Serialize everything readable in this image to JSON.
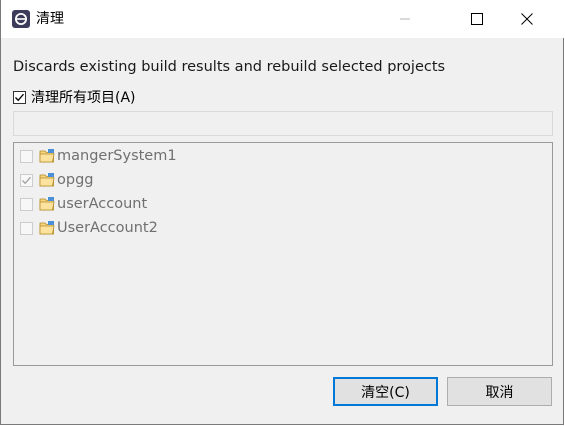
{
  "window": {
    "title": "清理",
    "controls": {
      "minimize": "minimize-icon",
      "maximize": "maximize-icon",
      "close": "close-icon"
    }
  },
  "dialog": {
    "description": "Discards existing build results and rebuild selected projects",
    "clean_all": {
      "label": "清理所有项目(A)",
      "checked": true
    },
    "filter": {
      "value": ""
    },
    "projects": [
      {
        "name": "mangerSystem1",
        "checked": false
      },
      {
        "name": "opgg",
        "checked": true
      },
      {
        "name": "userAccount",
        "checked": false
      },
      {
        "name": "UserAccount2",
        "checked": false
      }
    ]
  },
  "buttons": {
    "clean_label": "清空(C)",
    "cancel_label": "取消"
  },
  "colors": {
    "accent": "#0078d7",
    "disabled_text": "#707070"
  }
}
